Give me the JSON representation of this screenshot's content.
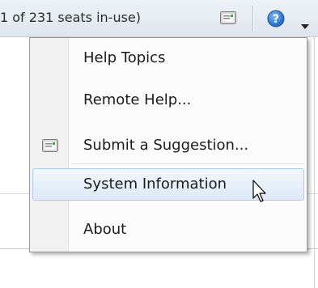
{
  "toolbar": {
    "seats_text": "1 of 231 seats in-use)",
    "suggestion_icon": "suggestion-card-icon",
    "help_icon": "help-question-icon",
    "dropdown_icon": "caret-down-icon"
  },
  "help_menu": {
    "items": [
      {
        "label": "Help Topics"
      },
      {
        "label": "Remote Help..."
      },
      {
        "label": "Submit a Suggestion...",
        "icon": "suggestion-card-icon"
      },
      {
        "label": "System Information",
        "state": "hovered"
      },
      {
        "label": "About"
      }
    ]
  },
  "colors": {
    "highlight_border": "#aecaf0",
    "highlight_fill": "#dde9f7",
    "help_icon_blue": "#2d7bd3"
  },
  "cursor": {
    "icon": "mouse-pointer-icon"
  }
}
